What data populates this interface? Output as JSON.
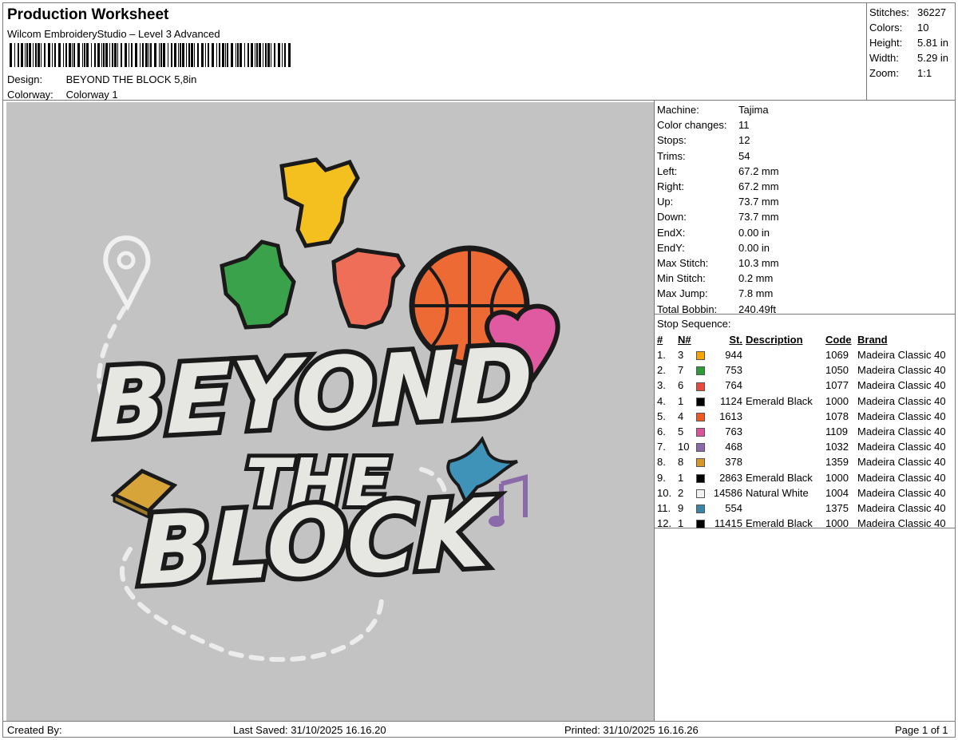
{
  "header": {
    "title": "Production Worksheet",
    "software": "Wilcom EmbroideryStudio – Level 3 Advanced",
    "design_label": "Design:",
    "design_value": "BEYOND THE BLOCK 5,8in",
    "colorway_label": "Colorway:",
    "colorway_value": "Colorway 1"
  },
  "stats": [
    {
      "label": "Stitches:",
      "value": "36227"
    },
    {
      "label": "Colors:",
      "value": "10"
    },
    {
      "label": "Height:",
      "value": "5.81 in"
    },
    {
      "label": "Width:",
      "value": "5.29 in"
    },
    {
      "label": "Zoom:",
      "value": "1:1"
    }
  ],
  "properties": [
    {
      "label": "Machine:",
      "value": "Tajima"
    },
    {
      "label": "Color changes:",
      "value": "11"
    },
    {
      "label": "Stops:",
      "value": "12"
    },
    {
      "label": "Trims:",
      "value": "54"
    },
    {
      "label": "Left:",
      "value": "67.2 mm"
    },
    {
      "label": "Right:",
      "value": "67.2 mm"
    },
    {
      "label": "Up:",
      "value": "73.7 mm"
    },
    {
      "label": "Down:",
      "value": "73.7 mm"
    },
    {
      "label": "EndX:",
      "value": "0.00 in"
    },
    {
      "label": "EndY:",
      "value": "0.00 in"
    },
    {
      "label": "Max Stitch:",
      "value": "10.3 mm"
    },
    {
      "label": "Min Stitch:",
      "value": "0.2 mm"
    },
    {
      "label": "Max Jump:",
      "value": "7.8 mm"
    },
    {
      "label": "Total Bobbin:",
      "value": "240.49ft"
    }
  ],
  "stop_sequence": {
    "title": "Stop Sequence:",
    "headers": [
      "#",
      "N#",
      "St.",
      "Description",
      "Code",
      "Brand"
    ],
    "rows": [
      {
        "num": "1.",
        "n": "3",
        "color": "#f7a600",
        "st": "944",
        "desc": "",
        "code": "1069",
        "brand": "Madeira Classic 40"
      },
      {
        "num": "2.",
        "n": "7",
        "color": "#2e9a3a",
        "st": "753",
        "desc": "",
        "code": "1050",
        "brand": "Madeira Classic 40"
      },
      {
        "num": "3.",
        "n": "6",
        "color": "#e84a3c",
        "st": "764",
        "desc": "",
        "code": "1077",
        "brand": "Madeira Classic 40"
      },
      {
        "num": "4.",
        "n": "1",
        "color": "#000000",
        "st": "1124",
        "desc": "Emerald Black",
        "code": "1000",
        "brand": "Madeira Classic 40"
      },
      {
        "num": "5.",
        "n": "4",
        "color": "#ee5a24",
        "st": "1613",
        "desc": "",
        "code": "1078",
        "brand": "Madeira Classic 40"
      },
      {
        "num": "6.",
        "n": "5",
        "color": "#d9549a",
        "st": "763",
        "desc": "",
        "code": "1109",
        "brand": "Madeira Classic 40"
      },
      {
        "num": "7.",
        "n": "10",
        "color": "#8a6aa8",
        "st": "468",
        "desc": "",
        "code": "1032",
        "brand": "Madeira Classic 40"
      },
      {
        "num": "8.",
        "n": "8",
        "color": "#d39a2a",
        "st": "378",
        "desc": "",
        "code": "1359",
        "brand": "Madeira Classic 40"
      },
      {
        "num": "9.",
        "n": "1",
        "color": "#000000",
        "st": "2863",
        "desc": "Emerald Black",
        "code": "1000",
        "brand": "Madeira Classic 40"
      },
      {
        "num": "10.",
        "n": "2",
        "color": "#f2f2f2",
        "st": "14586",
        "desc": "Natural White",
        "code": "1004",
        "brand": "Madeira Classic 40"
      },
      {
        "num": "11.",
        "n": "9",
        "color": "#3d84a8",
        "st": "554",
        "desc": "",
        "code": "1375",
        "brand": "Madeira Classic 40"
      },
      {
        "num": "12.",
        "n": "1",
        "color": "#000000",
        "st": "11415",
        "desc": "Emerald Black",
        "code": "1000",
        "brand": "Madeira Classic 40"
      }
    ]
  },
  "artwork": {
    "line1": "BEYOND",
    "line2": "THE",
    "line3": "BLOCK"
  },
  "footer": {
    "created_by": "Created By:",
    "last_saved": "Last Saved: 31/10/2025 16.16.20",
    "printed": "Printed: 31/10/2025 16.16.26",
    "page": "Page 1 of 1"
  }
}
